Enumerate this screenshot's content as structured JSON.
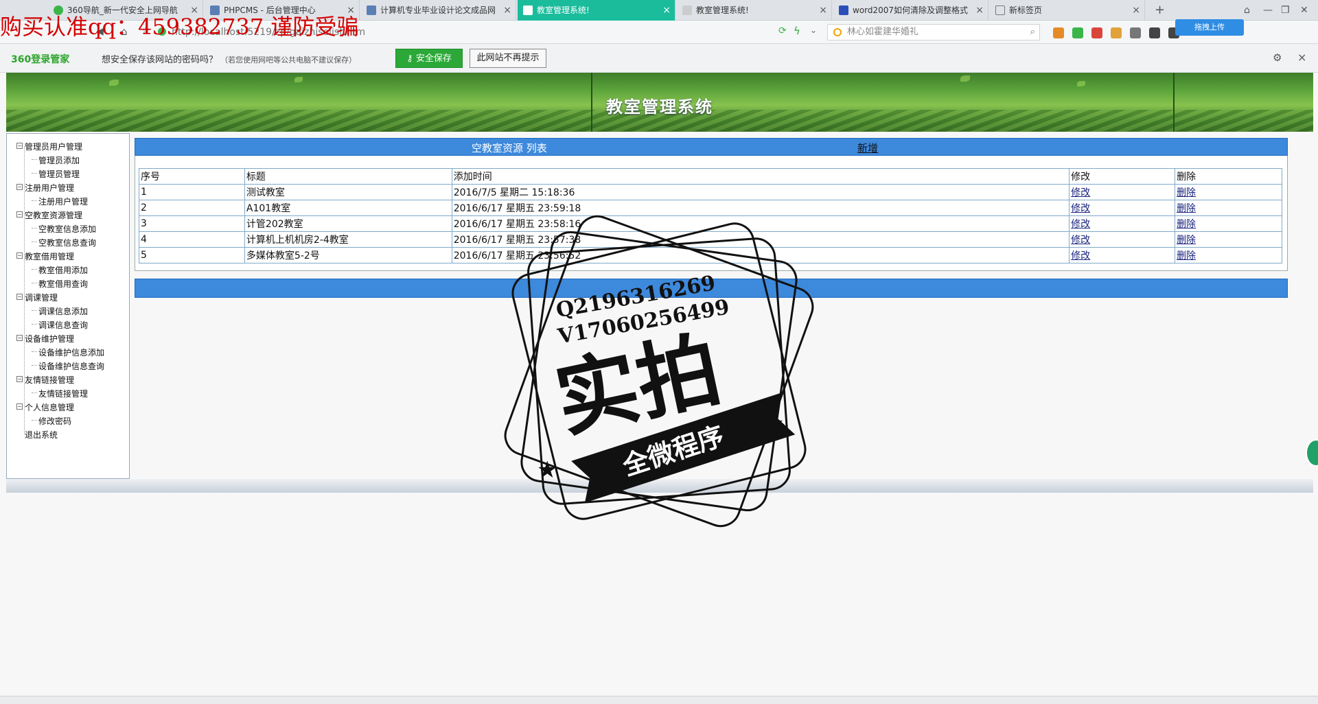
{
  "browser": {
    "tabs": [
      {
        "title": "360导航_新一代安全上网导航",
        "active": false
      },
      {
        "title": "PHPCMS - 后台管理中心",
        "active": false
      },
      {
        "title": "计算机专业毕业设计论文成品网",
        "active": false
      },
      {
        "title": "教室管理系统!",
        "active": true
      },
      {
        "title": "教室管理系统!",
        "active": false
      },
      {
        "title": "word2007如何清除及调整格式",
        "active": false
      },
      {
        "title": "新标签页",
        "active": false
      }
    ],
    "new_tab": "+",
    "url": "http://localhost:5219/zp/gaizhiselist.htm",
    "search_placeholder": "林心如霍建华婚礼",
    "upload_label": "拖拽上传"
  },
  "password_bar": {
    "logo": "360登录管家",
    "question": "想安全保存该网站的密码吗？",
    "note": "（若您使用网吧等公共电脑不建议保存）",
    "save_label": "安全保存",
    "no_more_label": "此网站不再提示"
  },
  "watermark": {
    "top_text": "购买认准qq：459382737 谨防受骗",
    "stamp_line1": "Q2196316269",
    "stamp_line2": "V17060256499",
    "stamp_main": "实拍",
    "stamp_ribbon": "全微程序"
  },
  "banner": {
    "title": "教室管理系统"
  },
  "sidebar": {
    "items": [
      {
        "label": "管理员用户管理",
        "level": 0
      },
      {
        "label": "管理员添加",
        "level": 1
      },
      {
        "label": "管理员管理",
        "level": 1
      },
      {
        "label": "注册用户管理",
        "level": 0
      },
      {
        "label": "注册用户管理",
        "level": 1
      },
      {
        "label": "空教室资源管理",
        "level": 0
      },
      {
        "label": "空教室信息添加",
        "level": 1
      },
      {
        "label": "空教室信息查询",
        "level": 1
      },
      {
        "label": "教室借用管理",
        "level": 0
      },
      {
        "label": "教室借用添加",
        "level": 1
      },
      {
        "label": "教室借用查询",
        "level": 1
      },
      {
        "label": "调课管理",
        "level": 0
      },
      {
        "label": "调课信息添加",
        "level": 1
      },
      {
        "label": "调课信息查询",
        "level": 1
      },
      {
        "label": "设备维护管理",
        "level": 0
      },
      {
        "label": "设备维护信息添加",
        "level": 1
      },
      {
        "label": "设备维护信息查询",
        "level": 1
      },
      {
        "label": "友情链接管理",
        "level": 0
      },
      {
        "label": "友情链接管理",
        "level": 1
      },
      {
        "label": "个人信息管理",
        "level": 0
      },
      {
        "label": "修改密码",
        "level": 1
      },
      {
        "label": "退出系统",
        "level": 0
      }
    ]
  },
  "main": {
    "panel_title": "空教室资源 列表",
    "add_label": "新增",
    "columns": [
      "序号",
      "标题",
      "添加时间",
      "修改",
      "删除"
    ],
    "rows": [
      {
        "id": "1",
        "title": "测试教室",
        "time": "2016/7/5 星期二 15:18:36",
        "edit": "修改",
        "delete": "删除"
      },
      {
        "id": "2",
        "title": "A101教室",
        "time": "2016/6/17 星期五 23:59:18",
        "edit": "修改",
        "delete": "删除"
      },
      {
        "id": "3",
        "title": "计管202教室",
        "time": "2016/6/17 星期五 23:58:16",
        "edit": "修改",
        "delete": "删除"
      },
      {
        "id": "4",
        "title": "计算机上机机房2-4教室",
        "time": "2016/6/17 星期五 23:57:38",
        "edit": "修改",
        "delete": "删除"
      },
      {
        "id": "5",
        "title": "多媒体教室5-2号",
        "time": "2016/6/17 星期五 23:56:52",
        "edit": "修改",
        "delete": "删除"
      }
    ]
  },
  "colors": {
    "panel_blue": "#3d89dc",
    "active_tab": "#1abc9c",
    "save_green": "#2ca838",
    "watermark_red": "#d40000"
  }
}
